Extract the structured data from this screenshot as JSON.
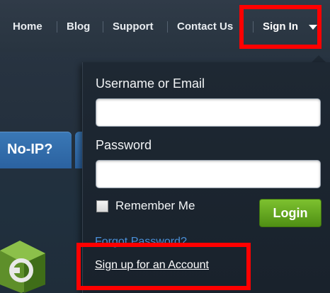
{
  "nav": {
    "items": [
      {
        "label": "Home"
      },
      {
        "label": "Blog"
      },
      {
        "label": "Support"
      },
      {
        "label": "Contact Us"
      }
    ],
    "signin_label": "Sign In"
  },
  "hero": {
    "tab_label": "No-IP?"
  },
  "login_dropdown": {
    "username_label": "Username or Email",
    "username_value": "",
    "password_label": "Password",
    "password_value": "",
    "remember_label": "Remember Me",
    "remember_checked": false,
    "login_button_label": "Login",
    "forgot_link": "Forgot Password?",
    "signup_link": "Sign up for an Account"
  },
  "colors": {
    "highlight": "#ff0000",
    "login_button": "#5fa11f",
    "link": "#4a90d9",
    "navbar": "#2c3744"
  }
}
